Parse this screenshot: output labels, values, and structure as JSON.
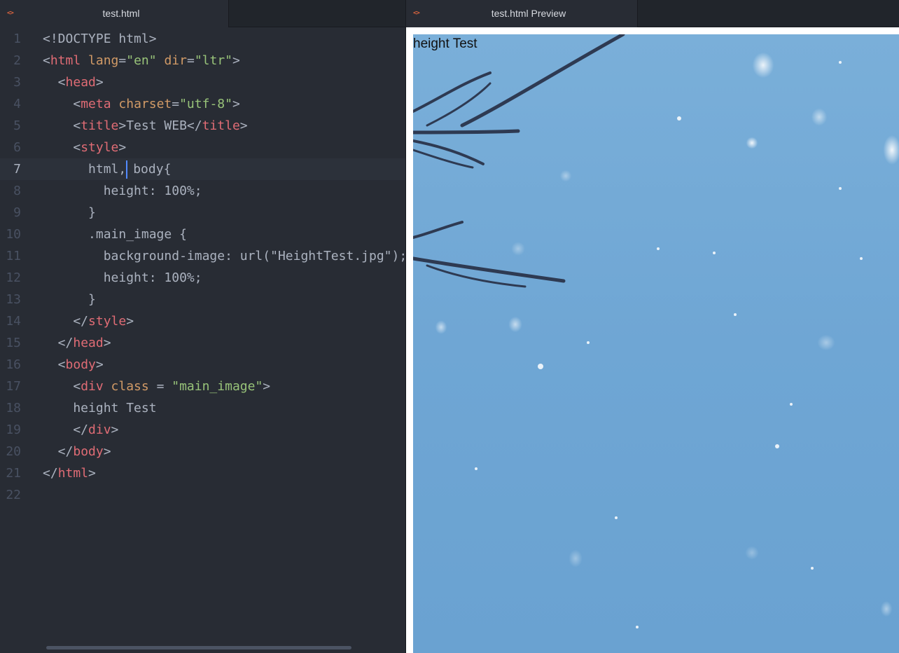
{
  "left_tab": {
    "icon": "code-file-icon",
    "title": "test.html"
  },
  "right_tab": {
    "icon": "code-file-icon",
    "title": "test.html Preview"
  },
  "editor": {
    "cursor_line": 7,
    "lines": [
      [
        [
          "plain",
          "<!DOCTYPE html>"
        ]
      ],
      [
        [
          "plain",
          "<"
        ],
        [
          "tag",
          "html"
        ],
        [
          "plain",
          " "
        ],
        [
          "attr",
          "lang"
        ],
        [
          "plain",
          "="
        ],
        [
          "str",
          "\"en\""
        ],
        [
          "plain",
          " "
        ],
        [
          "attr",
          "dir"
        ],
        [
          "plain",
          "="
        ],
        [
          "str",
          "\"ltr\""
        ],
        [
          "plain",
          ">"
        ]
      ],
      [
        [
          "plain",
          "  <"
        ],
        [
          "tag",
          "head"
        ],
        [
          "plain",
          ">"
        ]
      ],
      [
        [
          "plain",
          "    <"
        ],
        [
          "tag",
          "meta"
        ],
        [
          "plain",
          " "
        ],
        [
          "attr",
          "charset"
        ],
        [
          "plain",
          "="
        ],
        [
          "str",
          "\"utf-8\""
        ],
        [
          "plain",
          ">"
        ]
      ],
      [
        [
          "plain",
          "    <"
        ],
        [
          "tag",
          "title"
        ],
        [
          "plain",
          ">Test WEB</"
        ],
        [
          "tag",
          "title"
        ],
        [
          "plain",
          ">"
        ]
      ],
      [
        [
          "plain",
          "    <"
        ],
        [
          "tag",
          "style"
        ],
        [
          "plain",
          ">"
        ]
      ],
      [
        [
          "plain",
          "      html,"
        ],
        [
          "cursor",
          ""
        ],
        [
          "plain",
          "body{"
        ]
      ],
      [
        [
          "plain",
          "        height: 100%;"
        ]
      ],
      [
        [
          "plain",
          "      }"
        ]
      ],
      [
        [
          "plain",
          "      .main_image {"
        ]
      ],
      [
        [
          "plain",
          "        background-image: url(\"HeightTest.jpg\");"
        ]
      ],
      [
        [
          "plain",
          "        height: 100%;"
        ]
      ],
      [
        [
          "plain",
          "      }"
        ]
      ],
      [
        [
          "plain",
          "    </"
        ],
        [
          "tag",
          "style"
        ],
        [
          "plain",
          ">"
        ]
      ],
      [
        [
          "plain",
          "  </"
        ],
        [
          "tag",
          "head"
        ],
        [
          "plain",
          ">"
        ]
      ],
      [
        [
          "plain",
          "  <"
        ],
        [
          "tag",
          "body"
        ],
        [
          "plain",
          ">"
        ]
      ],
      [
        [
          "plain",
          "    <"
        ],
        [
          "tag",
          "div"
        ],
        [
          "plain",
          " "
        ],
        [
          "attr",
          "class"
        ],
        [
          "plain",
          " = "
        ],
        [
          "str",
          "\"main_image\""
        ],
        [
          "plain",
          ">"
        ]
      ],
      [
        [
          "plain",
          "    height Test"
        ]
      ],
      [
        [
          "plain",
          "    </"
        ],
        [
          "tag",
          "div"
        ],
        [
          "plain",
          ">"
        ]
      ],
      [
        [
          "plain",
          "  </"
        ],
        [
          "tag",
          "body"
        ],
        [
          "plain",
          ">"
        ]
      ],
      [
        [
          "plain",
          "</"
        ],
        [
          "tag",
          "html"
        ],
        [
          "plain",
          ">"
        ]
      ],
      []
    ]
  },
  "preview": {
    "body_text": "height Test"
  },
  "colors": {
    "editor_bg": "#282c34",
    "tag": "#e06c75",
    "attr": "#d19a66",
    "string": "#98c379",
    "text": "#abb2bf",
    "cursor": "#528bff",
    "tab_icon": "#e0663f",
    "preview_sky": "#6fa6d4"
  }
}
